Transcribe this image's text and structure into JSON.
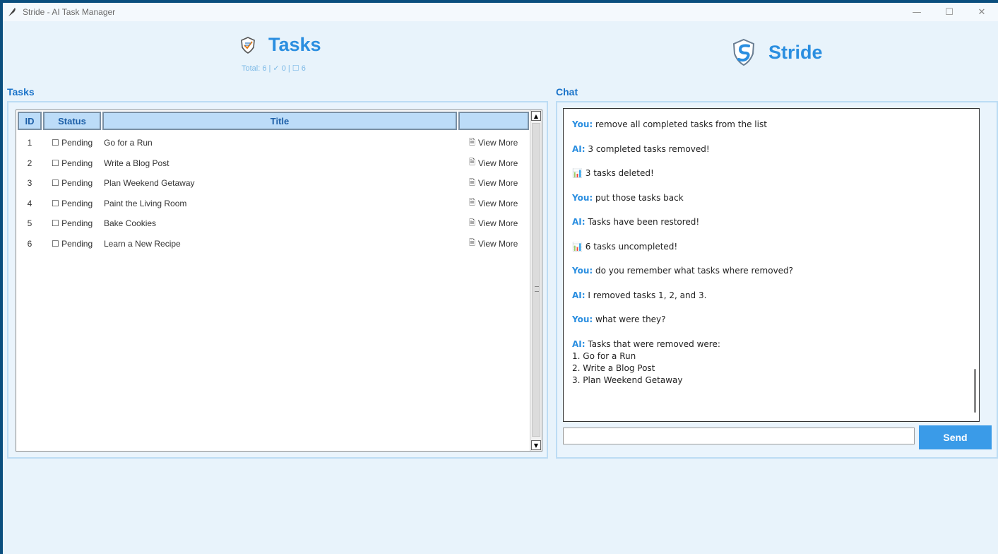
{
  "window": {
    "title": "Stride - AI Task Manager",
    "controls": [
      "—",
      "☐",
      "✕"
    ]
  },
  "header": {
    "tasks_title": "Tasks",
    "summary": "Total: 6 | ✓ 0 | ☐ 6",
    "brand": "Stride"
  },
  "tasks_section": {
    "label": "Tasks",
    "columns": [
      "ID",
      "Status",
      "Title",
      ""
    ],
    "rows": [
      {
        "id": "1",
        "status": "☐ Pending",
        "title": "Go for a Run",
        "action": "View More"
      },
      {
        "id": "2",
        "status": "☐ Pending",
        "title": "Write a Blog Post",
        "action": "View More"
      },
      {
        "id": "3",
        "status": "☐ Pending",
        "title": "Plan Weekend Getaway",
        "action": "View More"
      },
      {
        "id": "4",
        "status": "☐ Pending",
        "title": "Paint the Living Room",
        "action": "View More"
      },
      {
        "id": "5",
        "status": "☐ Pending",
        "title": "Bake Cookies",
        "action": "View More"
      },
      {
        "id": "6",
        "status": "☐ Pending",
        "title": "Learn a New Recipe",
        "action": "View More"
      }
    ]
  },
  "chat_section": {
    "label": "Chat",
    "messages": [
      {
        "speaker": "You:",
        "text": " remove all completed tasks from the list"
      },
      {
        "speaker": "AI:",
        "text": " 3 completed tasks removed!"
      },
      {
        "speaker": "",
        "text": "📊 3 tasks deleted!"
      },
      {
        "speaker": "You:",
        "text": " put those tasks back"
      },
      {
        "speaker": "AI:",
        "text": " Tasks have been restored!"
      },
      {
        "speaker": "",
        "text": "📊 6 tasks uncompleted!"
      },
      {
        "speaker": "You:",
        "text": " do you remember what tasks where removed?"
      },
      {
        "speaker": "AI:",
        "text": " I removed tasks 1, 2, and 3."
      },
      {
        "speaker": "You:",
        "text": " what were they?"
      },
      {
        "speaker": "AI:",
        "text": " Tasks that were removed were:\n1. Go for a Run\n2. Write a Blog Post\n3. Plan Weekend Getaway"
      }
    ],
    "input_value": "",
    "send_label": "Send"
  },
  "colors": {
    "accent": "#2a8ee0",
    "header_bg": "#bcdcf8",
    "send_bg": "#3a9be8",
    "frame": "#0a4e7e"
  }
}
